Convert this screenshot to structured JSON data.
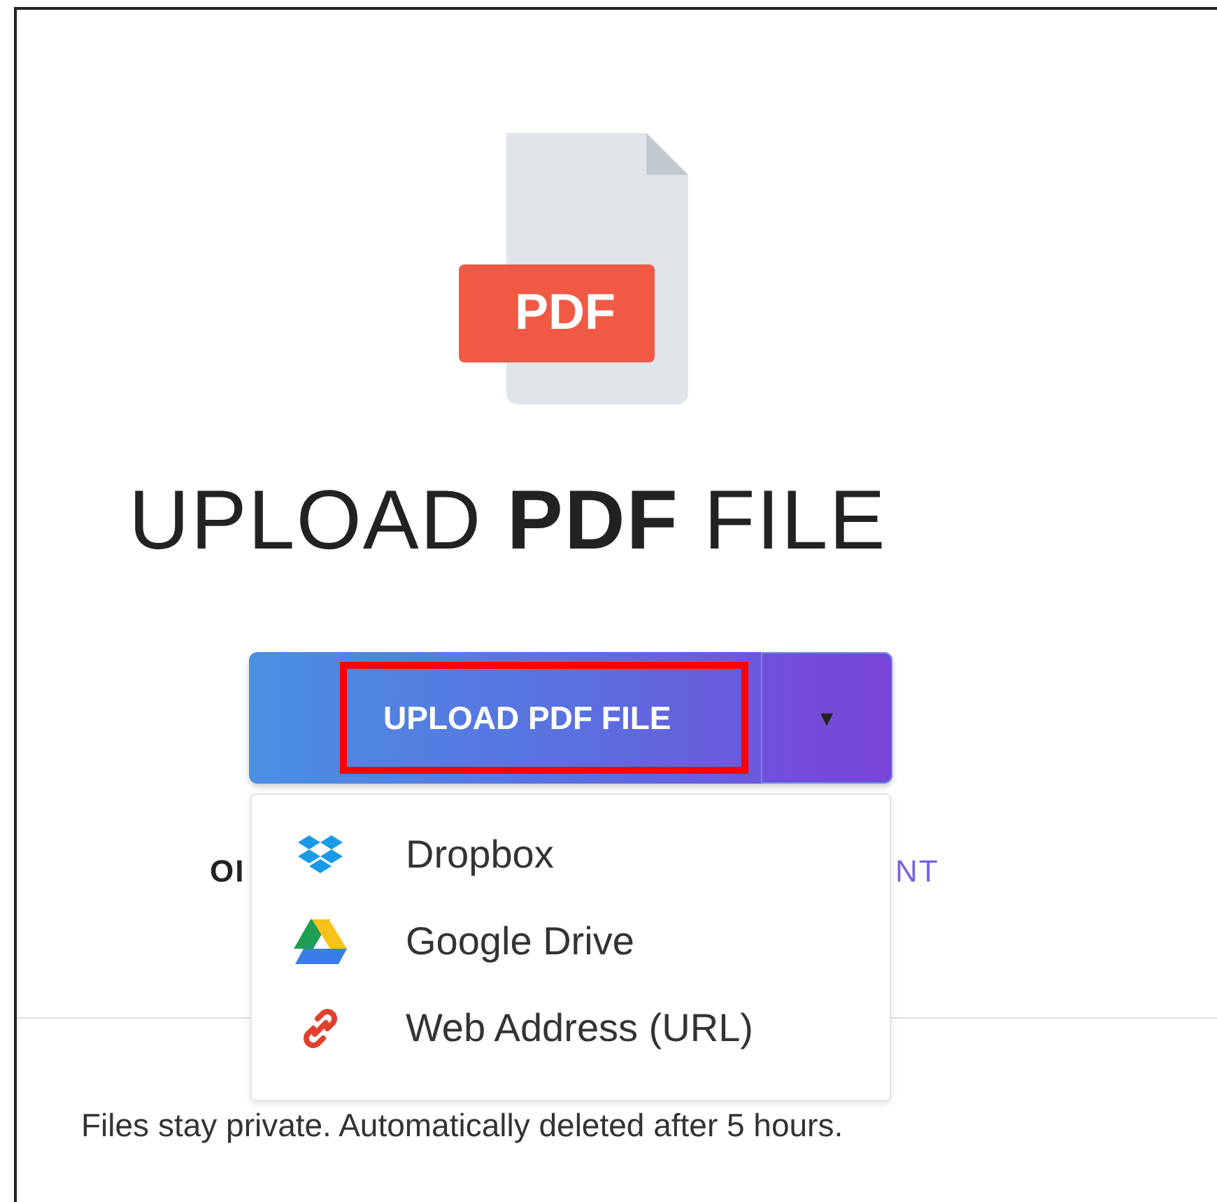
{
  "file_icon": {
    "badge": "PDF"
  },
  "heading": "UPLOAD **PDF** FILE",
  "upload_button": {
    "label": "UPLOAD PDF FILE",
    "highlighted": true,
    "caret": "▾",
    "expanded": true
  },
  "menu": [
    {
      "kind": "dropbox",
      "label": "Dropbox"
    },
    {
      "kind": "drive",
      "label": "Google Drive"
    },
    {
      "kind": "link",
      "label": "Web Address (URL)"
    }
  ],
  "behind_menu": {
    "left": "OI",
    "right": "NT"
  },
  "footer": "Files stay private. Automatically deleted after 5 hours."
}
